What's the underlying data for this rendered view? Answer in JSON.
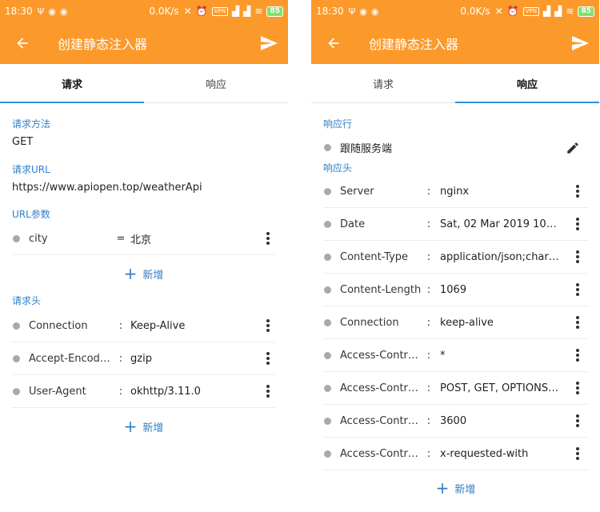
{
  "status": {
    "time": "18:30",
    "speed": "0.0K/s",
    "vpn": "VPN",
    "battery": "85"
  },
  "left": {
    "title": "创建静态注入器",
    "tabs": [
      {
        "label": "请求"
      },
      {
        "label": "响应"
      }
    ],
    "method_label": "请求方法",
    "method_value": "GET",
    "url_label": "请求URL",
    "url_value": "https://www.apiopen.top/weatherApi",
    "params_label": "URL参数",
    "params": [
      {
        "key": "city",
        "sep": "=",
        "value": "北京"
      }
    ],
    "add_label": "新增",
    "headers_label": "请求头",
    "headers": [
      {
        "key": "Connection",
        "sep": ":",
        "value": "Keep-Alive"
      },
      {
        "key": "Accept-Encod…",
        "sep": ":",
        "value": "gzip"
      },
      {
        "key": "User-Agent",
        "sep": ":",
        "value": "okhttp/3.11.0"
      }
    ]
  },
  "right": {
    "title": "创建静态注入器",
    "tabs": [
      {
        "label": "请求"
      },
      {
        "label": "响应"
      }
    ],
    "line_label": "响应行",
    "line_value": "跟随服务端",
    "headers_label": "响应头",
    "headers": [
      {
        "key": "Server",
        "sep": ":",
        "value": "nginx"
      },
      {
        "key": "Date",
        "sep": ":",
        "value": "Sat, 02 Mar 2019 10:2…"
      },
      {
        "key": "Content-Type",
        "sep": ":",
        "value": "application/json;chars…"
      },
      {
        "key": "Content-Length",
        "sep": ":",
        "value": "1069"
      },
      {
        "key": "Connection",
        "sep": ":",
        "value": "keep-alive"
      },
      {
        "key": "Access-Contr…",
        "sep": ":",
        "value": "*"
      },
      {
        "key": "Access-Contr…",
        "sep": ":",
        "value": "POST, GET, OPTIONS,…"
      },
      {
        "key": "Access-Contr…",
        "sep": ":",
        "value": "3600"
      },
      {
        "key": "Access-Contr…",
        "sep": ":",
        "value": "x-requested-with"
      }
    ],
    "add_label": "新增"
  },
  "colors": {
    "app_bar": "#fb9a2b",
    "accent_blue": "#2f7fc7",
    "tab_indicator": "#2f8fd8"
  }
}
